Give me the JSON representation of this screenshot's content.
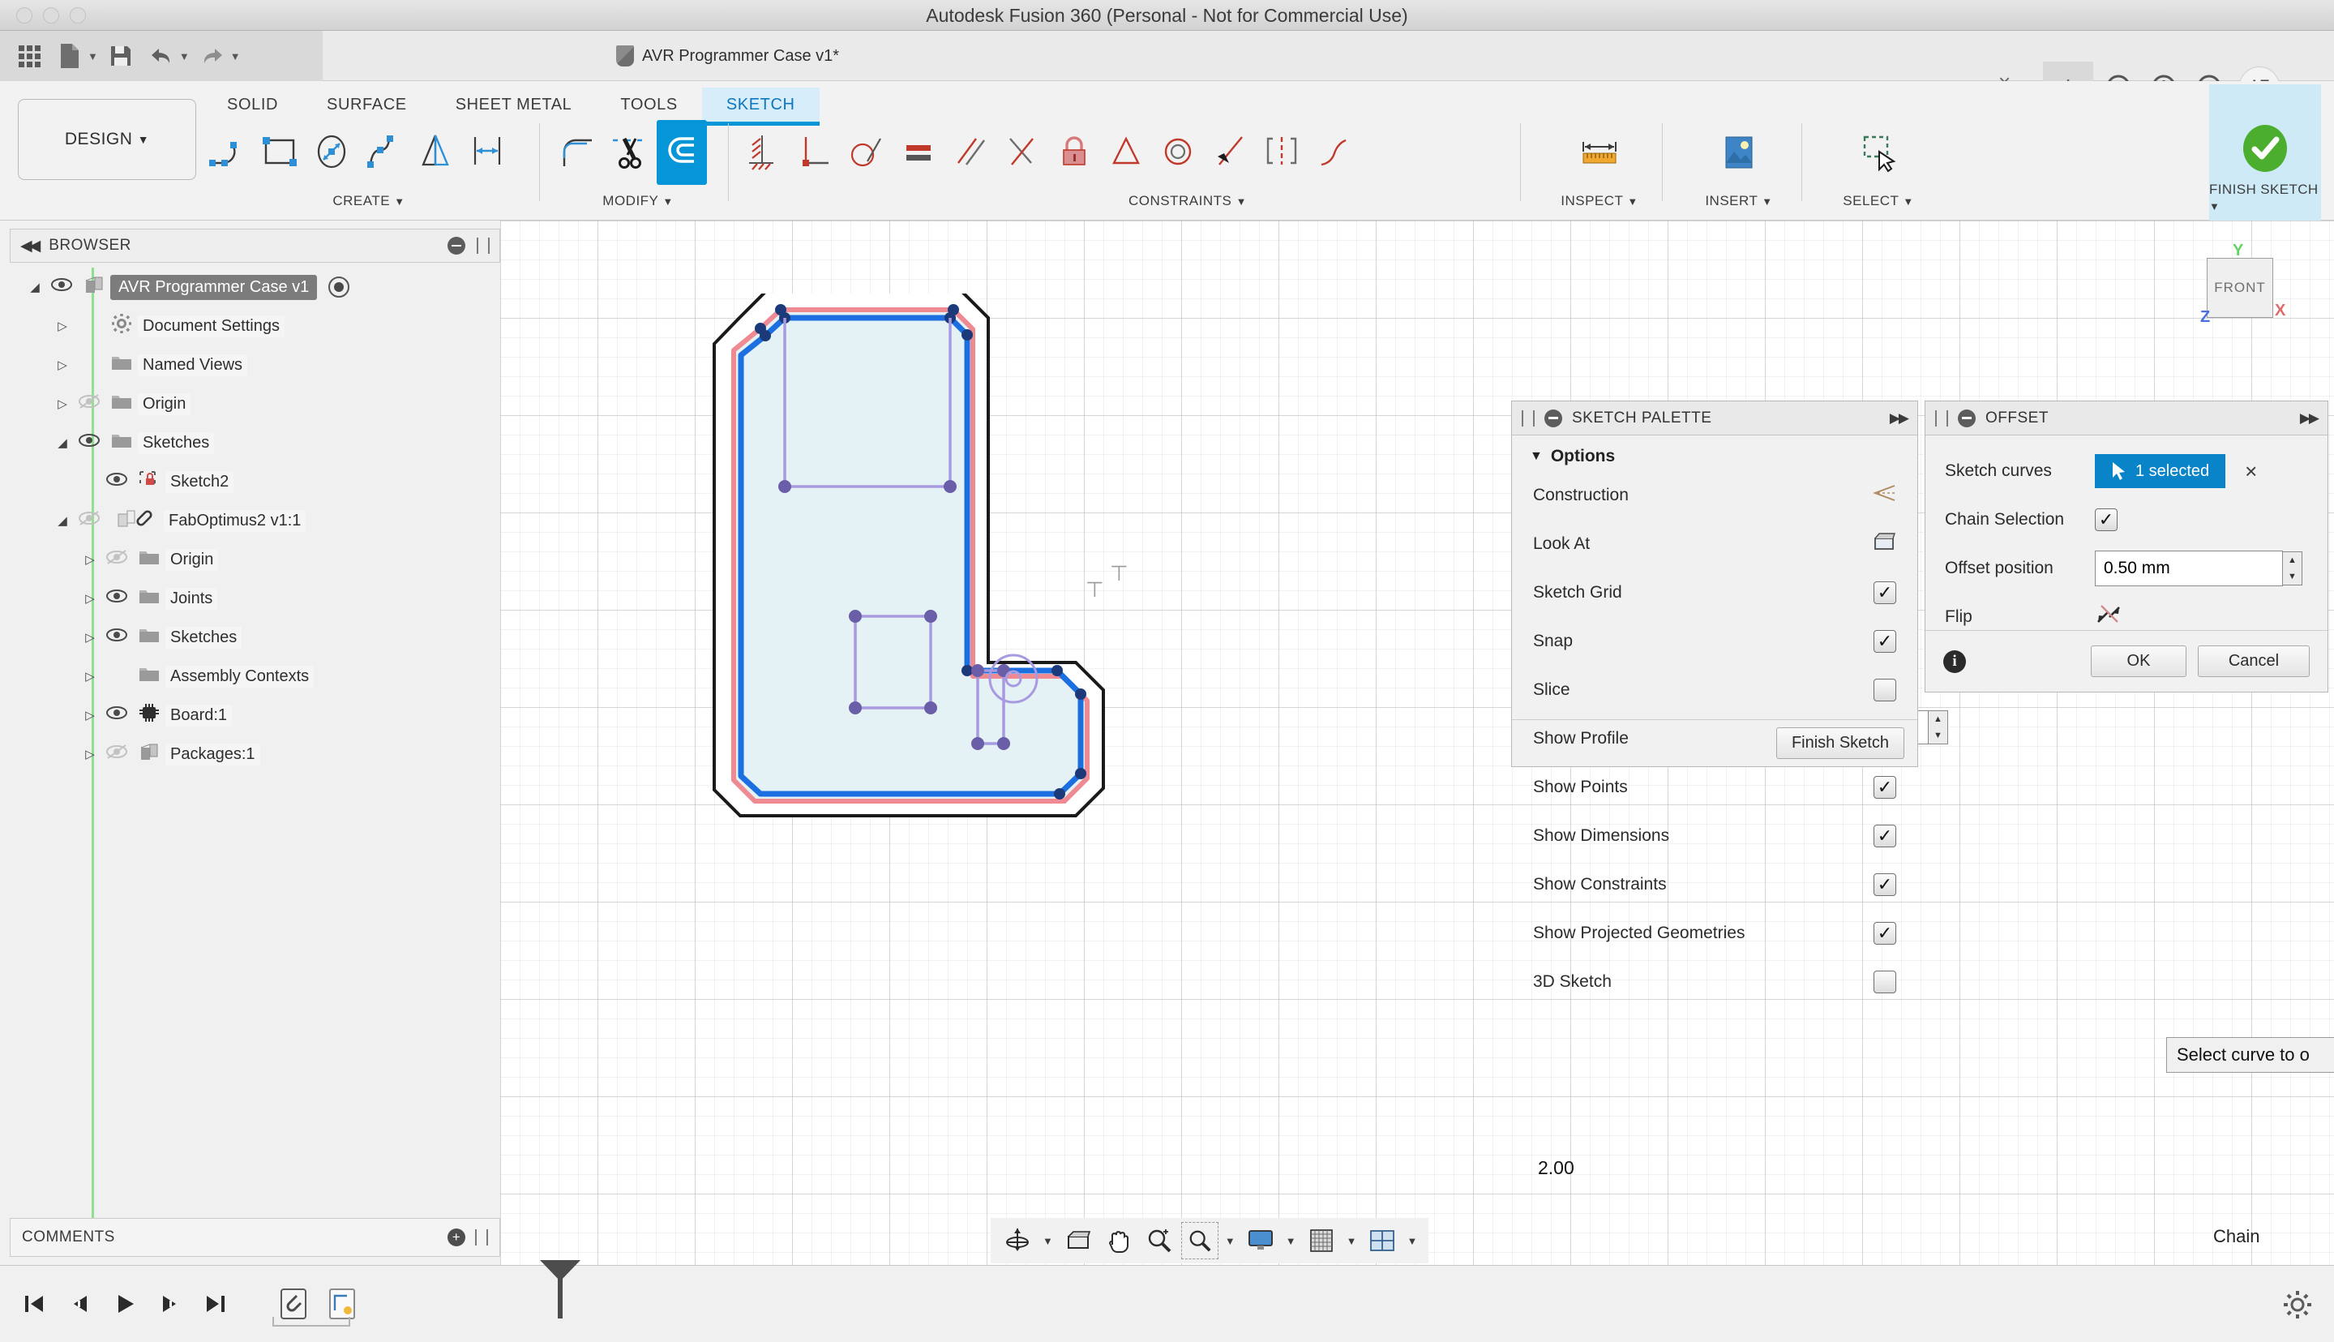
{
  "titlebar": {
    "title": "Autodesk Fusion 360 (Personal - Not for Commercial Use)"
  },
  "quick_access": {
    "icons": [
      "apps-grid-icon",
      "new-document-icon",
      "save-icon",
      "undo-icon",
      "redo-icon"
    ]
  },
  "document_tab": {
    "label": "AVR Programmer Case v1*",
    "close": "×",
    "new_tab": "+"
  },
  "header_icons": {
    "help_circle": "?",
    "avatar_initials": "AE"
  },
  "ribbon": {
    "design_button": "DESIGN",
    "tabs": [
      {
        "label": "SOLID",
        "active": false
      },
      {
        "label": "SURFACE",
        "active": false
      },
      {
        "label": "SHEET METAL",
        "active": false
      },
      {
        "label": "TOOLS",
        "active": false
      },
      {
        "label": "SKETCH",
        "active": true
      }
    ],
    "groups": [
      {
        "label": "CREATE",
        "items": [
          "line-icon",
          "rectangle-icon",
          "circle-icon",
          "spline-icon",
          "mirror-icon",
          "dimension-icon"
        ]
      },
      {
        "label": "MODIFY",
        "items": [
          "fillet-icon",
          "trim-scissors-icon",
          "offset-icon"
        ]
      },
      {
        "label": "CONSTRAINTS",
        "items": [
          "horizontal-vertical-icon",
          "perpendicular-icon",
          "tangent-icon",
          "equal-icon",
          "parallel-icon",
          "midpoint-icon",
          "fix-lock-icon",
          "concentric-triangle-icon",
          "concentric-icon",
          "collinear-icon",
          "symmetry-icon",
          "curvature-icon"
        ]
      },
      {
        "label": "INSPECT",
        "items": [
          "measure-ruler-icon"
        ]
      },
      {
        "label": "INSERT",
        "items": [
          "insert-image-icon"
        ]
      },
      {
        "label": "SELECT",
        "items": [
          "select-window-icon"
        ]
      },
      {
        "label": "FINISH SKETCH",
        "items": [
          "finish-check-icon"
        ]
      }
    ],
    "selected_tool": "offset-icon"
  },
  "browser": {
    "title": "BROWSER",
    "nodes": [
      {
        "label": "AVR Programmer Case v1",
        "indent": 0,
        "arrow": "expanded",
        "eye": "visible",
        "icon": "component-icon",
        "selected": true,
        "radio": true
      },
      {
        "label": "Document Settings",
        "indent": 1,
        "arrow": "collapsed",
        "eye": "none",
        "icon": "gear-icon",
        "selected": false,
        "radio": false
      },
      {
        "label": "Named Views",
        "indent": 1,
        "arrow": "collapsed",
        "eye": "none",
        "icon": "folder-icon",
        "selected": false,
        "radio": false
      },
      {
        "label": "Origin",
        "indent": 1,
        "arrow": "collapsed",
        "eye": "hidden",
        "icon": "folder-icon",
        "selected": false,
        "radio": false
      },
      {
        "label": "Sketches",
        "indent": 1,
        "arrow": "expanded",
        "eye": "visible",
        "icon": "folder-icon",
        "selected": false,
        "radio": false
      },
      {
        "label": "Sketch2",
        "indent": 2,
        "arrow": "none",
        "eye": "visible",
        "icon": "sketch-lock-icon",
        "selected": false,
        "radio": false
      },
      {
        "label": "FabOptimus2 v1:1",
        "indent": 1,
        "arrow": "expanded",
        "eye": "hidden",
        "icon": "linked-component-icon",
        "selected": false,
        "radio": false
      },
      {
        "label": "Origin",
        "indent": 2,
        "arrow": "collapsed",
        "eye": "hidden",
        "icon": "folder-icon",
        "selected": false,
        "radio": false
      },
      {
        "label": "Joints",
        "indent": 2,
        "arrow": "collapsed",
        "eye": "visible",
        "icon": "folder-icon",
        "selected": false,
        "radio": false
      },
      {
        "label": "Sketches",
        "indent": 2,
        "arrow": "collapsed",
        "eye": "visible",
        "icon": "folder-icon",
        "selected": false,
        "radio": false
      },
      {
        "label": "Assembly Contexts",
        "indent": 2,
        "arrow": "collapsed",
        "eye": "none",
        "icon": "folder-icon",
        "selected": false,
        "radio": false
      },
      {
        "label": "Board:1",
        "indent": 2,
        "arrow": "collapsed",
        "eye": "visible",
        "icon": "chip-icon",
        "selected": false,
        "radio": false
      },
      {
        "label": "Packages:1",
        "indent": 2,
        "arrow": "collapsed",
        "eye": "hidden",
        "icon": "component-icon",
        "selected": false,
        "radio": false
      }
    ]
  },
  "canvas": {
    "offset_value_field": "0.50 mm",
    "dimension_label": "2.00",
    "viewcube_face": "FRONT",
    "axes": {
      "x": "X",
      "y": "Y",
      "z": "Z"
    },
    "colors": {
      "original_curve": "#ef8a92",
      "offset_curve": "#1c6fe0",
      "construction": "#a89ae0",
      "body_outline": "#1a1a1a",
      "profile_fill": "#e6f2f6",
      "selection_accent": "#0a84c8"
    }
  },
  "sketch_palette": {
    "title": "SKETCH PALETTE",
    "section": "Options",
    "options": [
      {
        "label": "Construction",
        "control": "construction-icon",
        "checked": null
      },
      {
        "label": "Look At",
        "control": "look-at-icon",
        "checked": null
      },
      {
        "label": "Sketch Grid",
        "control": "checkbox",
        "checked": true
      },
      {
        "label": "Snap",
        "control": "checkbox",
        "checked": true
      },
      {
        "label": "Slice",
        "control": "checkbox",
        "checked": false
      },
      {
        "label": "Show Profile",
        "control": "checkbox",
        "checked": true
      },
      {
        "label": "Show Points",
        "control": "checkbox",
        "checked": true
      },
      {
        "label": "Show Dimensions",
        "control": "checkbox",
        "checked": true
      },
      {
        "label": "Show Constraints",
        "control": "checkbox",
        "checked": true
      },
      {
        "label": "Show Projected Geometries",
        "control": "checkbox",
        "checked": true
      },
      {
        "label": "3D Sketch",
        "control": "checkbox",
        "checked": false
      }
    ],
    "finish_button": "Finish Sketch"
  },
  "offset_dialog": {
    "title": "OFFSET",
    "rows": {
      "sketch_curves_label": "Sketch curves",
      "sketch_curves_value": "1 selected",
      "clear_selection": "×",
      "chain_selection_label": "Chain Selection",
      "chain_selection_checked": true,
      "offset_position_label": "Offset position",
      "offset_position_value": "0.50 mm",
      "flip_label": "Flip",
      "flip_icon": "flip-arrows-icon"
    },
    "ok": "OK",
    "cancel": "Cancel"
  },
  "tooltip": {
    "text": "Select curve to o"
  },
  "status": {
    "chain_label": "Chain"
  },
  "navbar": {
    "items": [
      "orbit-icon",
      "look-at-icon",
      "pan-hand-icon",
      "zoom-icon",
      "fit-icon",
      "display-settings-icon",
      "grid-snap-icon",
      "viewports-icon"
    ]
  },
  "comments": {
    "title": "COMMENTS"
  },
  "timeline": {
    "controls": [
      "go-to-start-icon",
      "step-back-icon",
      "play-icon",
      "step-forward-icon",
      "go-to-end-icon"
    ],
    "features": [
      "link-paperclip-icon",
      "sketch-feature-icon"
    ],
    "settings": "gear-icon"
  }
}
